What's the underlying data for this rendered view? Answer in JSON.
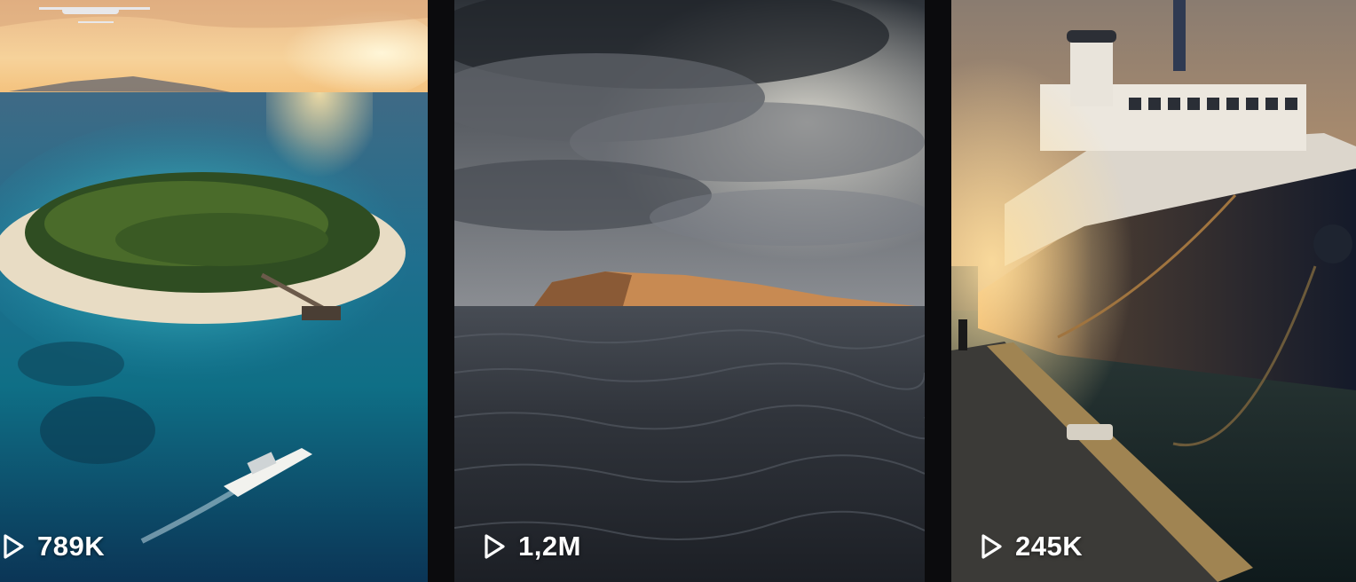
{
  "feed": {
    "items": [
      {
        "views": "789K",
        "icon": "play-icon"
      },
      {
        "views": "1,2M",
        "icon": "play-icon"
      },
      {
        "views": "245K",
        "icon": "play-icon"
      }
    ]
  },
  "colors": {
    "background": "#0b0b0d",
    "text": "#ffffff"
  }
}
